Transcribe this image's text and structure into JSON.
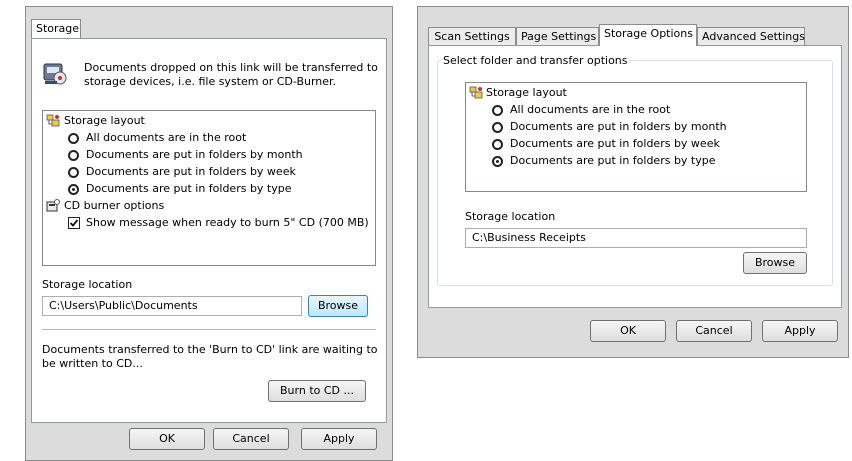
{
  "left_dialog": {
    "tab_label": "Storage",
    "intro_text_line1": "Documents dropped on this link will be transferred to",
    "intro_text_line2": "storage devices, i.e. file system or CD-Burner.",
    "storage_layout_label": "Storage layout",
    "layout_options": [
      {
        "label": "All documents are in the root",
        "checked": false
      },
      {
        "label": "Documents are put in folders by month",
        "checked": false
      },
      {
        "label": "Documents are put in folders by week",
        "checked": false
      },
      {
        "label": "Documents are put in folders by type",
        "checked": true
      }
    ],
    "cd_burner_label": "CD burner options",
    "cd_option_label": "Show message when ready to burn 5\" CD (700 MB)",
    "storage_location_label": "Storage location",
    "storage_location_value": "C:\\Users\\Public\\Documents",
    "browse_label": "Browse",
    "burn_text_line1": "Documents transferred to the 'Burn to CD' link are waiting to",
    "burn_text_line2": "be written to CD...",
    "burn_button_label": "Burn to CD ...",
    "ok_label": "OK",
    "cancel_label": "Cancel",
    "apply_label": "Apply"
  },
  "right_dialog": {
    "tabs": [
      "Scan Settings",
      "Page Settings",
      "Storage Options",
      "Advanced Settings"
    ],
    "active_tab": "Storage Options",
    "group_label": "Select folder and transfer options",
    "storage_layout_label": "Storage layout",
    "layout_options": [
      {
        "label": "All documents are in the root",
        "checked": false
      },
      {
        "label": "Documents are put in folders by month",
        "checked": false
      },
      {
        "label": "Documents are put in folders by week",
        "checked": false
      },
      {
        "label": "Documents are put in folders by type",
        "checked": true
      }
    ],
    "storage_location_label": "Storage location",
    "storage_location_value": "C:\\Business Receipts",
    "browse_label": "Browse",
    "ok_label": "OK",
    "cancel_label": "Cancel",
    "apply_label": "Apply"
  }
}
